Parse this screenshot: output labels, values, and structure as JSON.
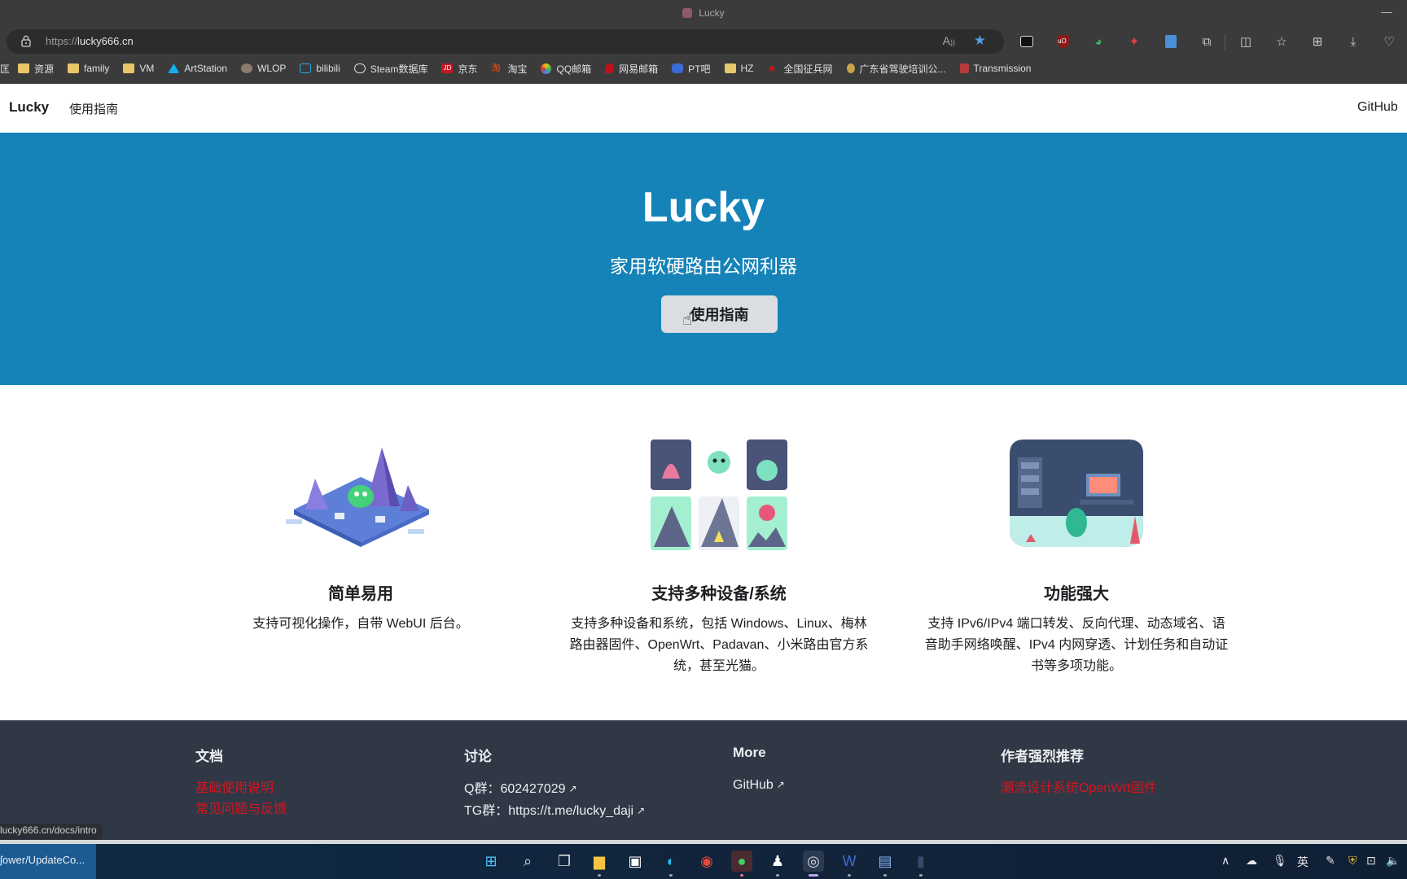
{
  "browser": {
    "tab_title": "Lucky",
    "url_protocol": "https://",
    "url_host": "lucky666.cn",
    "toolbar_icons": [
      "read-aloud-icon",
      "favorite-star-icon",
      "extension-dots-icon",
      "ublock-icon",
      "extension-green-icon",
      "extension-colorful-icon",
      "extension-blue-icon",
      "extensions-puzzle-icon",
      "split-screen-icon",
      "favorites-icon",
      "collections-icon",
      "downloads-icon",
      "browser-essentials-icon"
    ],
    "bookmarks": [
      {
        "label": "资源",
        "icon": "folder-icon"
      },
      {
        "label": "family",
        "icon": "folder-icon"
      },
      {
        "label": "VM",
        "icon": "folder-icon"
      },
      {
        "label": "ArtStation",
        "icon": "artstation-icon"
      },
      {
        "label": "WLOP",
        "icon": "avatar-icon"
      },
      {
        "label": "bilibili",
        "icon": "bilibili-icon"
      },
      {
        "label": "Steam数据库",
        "icon": "steamdb-icon"
      },
      {
        "label": "京东",
        "icon": "jd-icon"
      },
      {
        "label": "淘宝",
        "icon": "taobao-icon"
      },
      {
        "label": "QQ邮箱",
        "icon": "qqmail-icon"
      },
      {
        "label": "网易邮箱",
        "icon": "netease-icon"
      },
      {
        "label": "PT吧",
        "icon": "baidu-icon"
      },
      {
        "label": "HZ",
        "icon": "folder-icon"
      },
      {
        "label": "全国征兵网",
        "icon": "star-icon"
      },
      {
        "label": "广东省驾驶培训公...",
        "icon": "emblem-icon"
      },
      {
        "label": "Transmission",
        "icon": "transmission-icon"
      }
    ],
    "status_url": "lucky666.cn/docs/intro"
  },
  "navbar": {
    "brand": "Lucky",
    "guide_link": "使用指南",
    "github_link": "GitHub"
  },
  "hero": {
    "title": "Lucky",
    "subtitle": "家用软硬路由公网利器",
    "button_label": "使用指南",
    "background_color": "#1583b8"
  },
  "features": [
    {
      "title": "简单易用",
      "description": "支持可视化操作，自带 WebUI 后台。",
      "illustration": "isometric-landscape-illustration"
    },
    {
      "title": "支持多种设备/系统",
      "description": "支持多种设备和系统，包括 Windows、Linux、梅林路由器固件、OpenWrt、Padavan、小米路由官方系统，甚至光猫。",
      "illustration": "device-grid-illustration"
    },
    {
      "title": "功能强大",
      "description": "支持 IPv6/IPv4 端口转发、反向代理、动态域名、语音助手网络唤醒、IPv4 内网穿透、计划任务和自动证书等多项功能。",
      "illustration": "workshop-room-illustration"
    }
  ],
  "footer": {
    "columns": [
      {
        "title": "文档",
        "links": [
          {
            "label": "基础使用说明",
            "style": "red"
          },
          {
            "label": "常见问题与反馈",
            "style": "red"
          }
        ]
      },
      {
        "title": "讨论",
        "links": [
          {
            "label": "Q群：602427029",
            "external": true
          },
          {
            "label": "TG群：https://t.me/lucky_daji",
            "external": true
          }
        ]
      },
      {
        "title": "More",
        "links": [
          {
            "label": "GitHub",
            "external": true
          }
        ]
      },
      {
        "title": "作者强烈推荐",
        "links": [
          {
            "label": "潮流设计系统OpenWrt固件",
            "style": "red"
          }
        ]
      }
    ],
    "background_color": "#303846",
    "link_highlight_color": "#d4151f"
  },
  "taskbar": {
    "active_window_label": "ʃower/UpdateCo...",
    "apps": [
      "windows-start-icon",
      "search-icon",
      "task-view-icon",
      "file-explorer-icon",
      "microsoft-store-icon",
      "edge-icon",
      "chrome-icon",
      "wechat-icon",
      "qq-icon",
      "obs-icon",
      "word-icon",
      "remote-desktop-icon",
      "terminal-cat-icon"
    ],
    "tray": {
      "ime": "英"
    }
  }
}
